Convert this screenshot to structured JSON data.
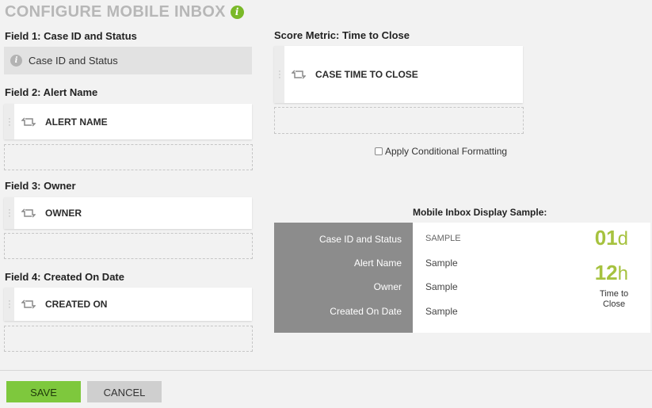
{
  "page": {
    "title": "CONFIGURE MOBILE INBOX"
  },
  "fields": {
    "field1": {
      "label": "Field 1: Case ID and Status",
      "value": "Case ID and Status"
    },
    "field2": {
      "label": "Field 2: Alert Name",
      "card": "ALERT NAME"
    },
    "field3": {
      "label": "Field 3: Owner",
      "card": "OWNER"
    },
    "field4": {
      "label": "Field 4: Created On Date",
      "card": "CREATED ON"
    }
  },
  "score_metric": {
    "label": "Score Metric: Time to Close",
    "card": "CASE TIME TO CLOSE"
  },
  "conditional_formatting": {
    "label": "Apply Conditional Formatting",
    "checked": false
  },
  "sample": {
    "title": "Mobile Inbox Display Sample:",
    "rows": [
      {
        "label": "Case ID and Status",
        "value": "SAMPLE"
      },
      {
        "label": "Alert Name",
        "value": "Sample"
      },
      {
        "label": "Owner",
        "value": "Sample"
      },
      {
        "label": "Created On Date",
        "value": "Sample"
      }
    ],
    "days_value": "01",
    "days_unit": "d",
    "hours_value": "12",
    "hours_unit": "h",
    "metric_caption": "Time to Close"
  },
  "footer": {
    "save_label": "SAVE",
    "cancel_label": "CANCEL"
  },
  "colors": {
    "accent_green": "#7ec83d",
    "metric_green": "#a6c23f",
    "sample_label_bg": "#8c8c8c"
  },
  "icons": {
    "title_info": "info-icon",
    "field_info": "info-icon",
    "card_handle": "drag-handle-icon",
    "card_swap": "swap-icon"
  }
}
